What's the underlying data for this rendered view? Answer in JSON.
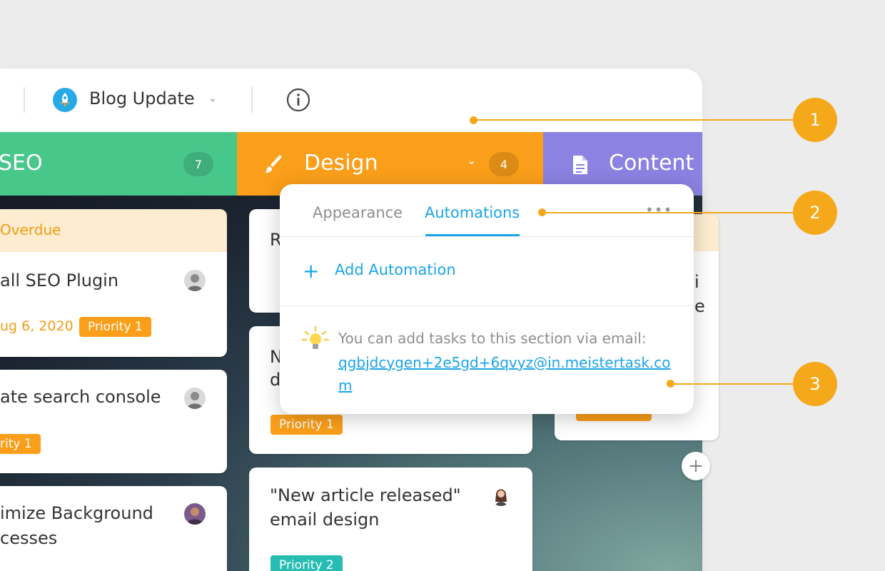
{
  "project": {
    "name": "Blog Update",
    "icon": "rocket-icon"
  },
  "columns": [
    {
      "name": "SEO",
      "count": "7",
      "color": "#48c78b"
    },
    {
      "name": "Design",
      "count": "4",
      "color": "#fb9f1a"
    },
    {
      "name": "Content",
      "color": "#8b82e2"
    }
  ],
  "seo_cards": [
    {
      "overdue": "Overdue",
      "title": "all SEO Plugin",
      "due": "ug 6, 2020",
      "tag": "Priority 1"
    },
    {
      "title": "ate search console",
      "tag": "rity 1"
    },
    {
      "title_line1": "imize Background",
      "title_line2": "cesses"
    }
  ],
  "design_cards": [
    {
      "title_fragment": "R"
    },
    {
      "title_fragment_1": "N",
      "title_fragment_2": "d",
      "tag": "Priority 1"
    },
    {
      "title_line1": "\"New article released\"",
      "title_line2": "email design",
      "tag": "Priority 2"
    }
  ],
  "content_cards": [
    {
      "fragment_1": "i",
      "fragment_2": "e"
    }
  ],
  "popover": {
    "tab_appearance": "Appearance",
    "tab_automations": "Automations",
    "more": "•••",
    "add_automation": "Add Automation",
    "hint": "You can add tasks to this section via email:",
    "email": "qgbjdcygen+2e5gd+6qvyz@in.meistertask.com"
  },
  "callouts": [
    "1",
    "2",
    "3"
  ],
  "accent_color": "#1aa5e8",
  "callout_color": "#f5a91a"
}
